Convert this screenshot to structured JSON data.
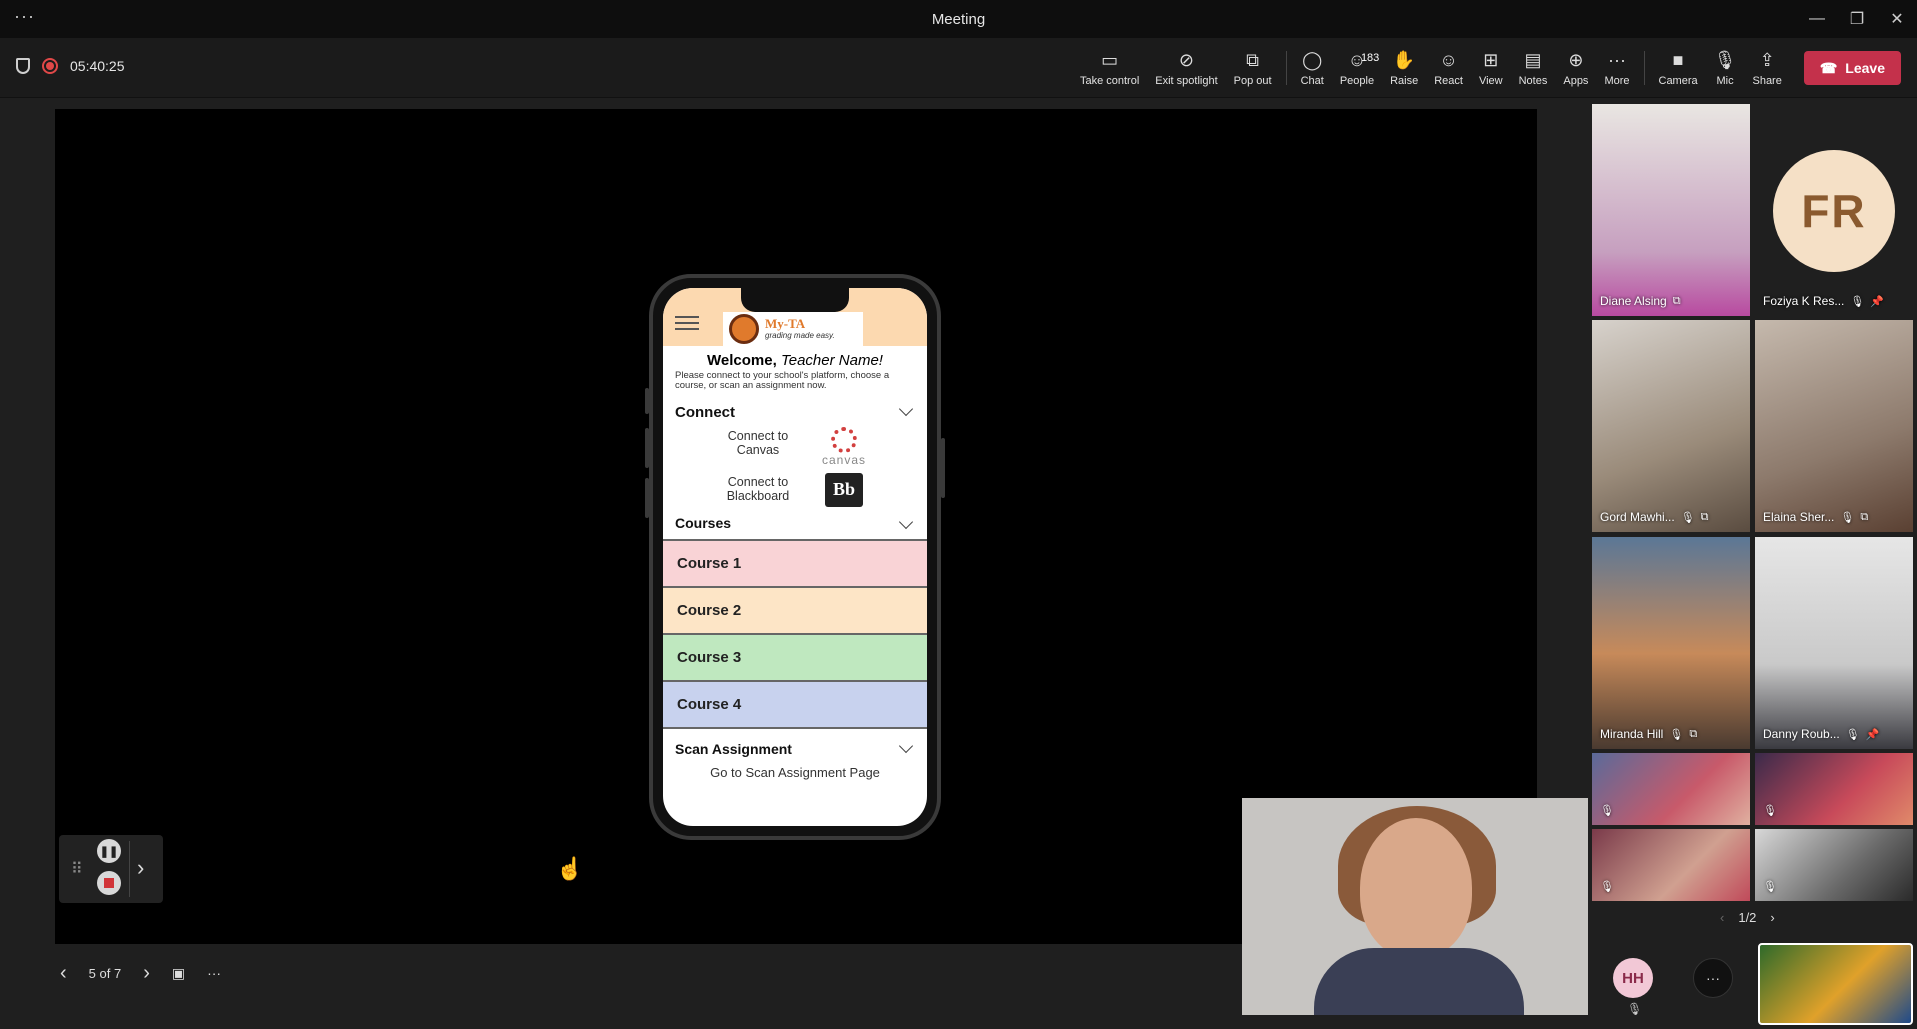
{
  "window": {
    "title": "Meeting"
  },
  "recording": {
    "elapsed": "05:40:25"
  },
  "toolbar": {
    "take_control": "Take control",
    "exit_spotlight": "Exit spotlight",
    "pop_out": "Pop out",
    "chat": "Chat",
    "people": "People",
    "people_count": "183",
    "raise": "Raise",
    "react": "React",
    "view": "View",
    "notes": "Notes",
    "apps": "Apps",
    "more": "More",
    "camera": "Camera",
    "mic": "Mic",
    "share": "Share",
    "leave": "Leave"
  },
  "phone_app": {
    "logo_title": "My-TA",
    "logo_tagline": "grading made easy.",
    "welcome_prefix": "Welcome, ",
    "welcome_name": "Teacher Name!",
    "subtitle": "Please connect to your school's platform, choose a course, or scan an assignment now.",
    "connect_header": "Connect",
    "connect_canvas": "Connect to Canvas",
    "canvas_word": "canvas",
    "connect_blackboard": "Connect to Blackboard",
    "blackboard_mark": "Bb",
    "courses_header": "Courses",
    "courses": [
      {
        "label": "Course 1",
        "color": "#f9d3d6"
      },
      {
        "label": "Course 2",
        "color": "#fde5c6"
      },
      {
        "label": "Course 3",
        "color": "#bfe8bf"
      },
      {
        "label": "Course 4",
        "color": "#c8d2ee"
      }
    ],
    "scan_header": "Scan Assignment",
    "scan_link": "Go to Scan Assignment Page"
  },
  "slide_nav": {
    "counter": "5 of 7"
  },
  "participants": [
    {
      "name": "Diane Alsing"
    },
    {
      "name": "Foziya K Res...",
      "initials": "FR"
    },
    {
      "name": "Gord Mawhi..."
    },
    {
      "name": "Elaina Sher..."
    },
    {
      "name": "Miranda Hill"
    },
    {
      "name": "Danny Roub..."
    }
  ],
  "gallery_pager": {
    "page": "1/2"
  },
  "self_avatar": {
    "initials": "HH"
  },
  "colors": {
    "leave": "#c4314b",
    "recording": "#e04848",
    "phone_header": "#fcd9b0"
  }
}
